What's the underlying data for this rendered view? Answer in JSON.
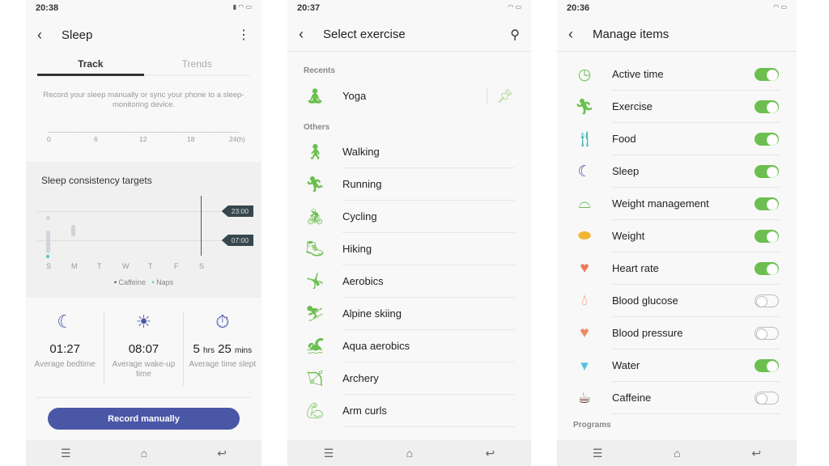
{
  "sleep": {
    "time": "20:38",
    "title": "Sleep",
    "tabs": [
      "Track",
      "Trends"
    ],
    "hint": "Record your sleep manually or sync your phone to a sleep-monitoring device.",
    "axis_ticks": [
      "0",
      "6",
      "12",
      "18",
      "24(h)"
    ],
    "consistency": {
      "title": "Sleep consistency targets",
      "targets": [
        "23:00",
        "07:00"
      ],
      "days": [
        "S",
        "M",
        "T",
        "W",
        "T",
        "F",
        "S"
      ],
      "legend": [
        "Caffeine",
        "Naps"
      ],
      "legend_colors": [
        "#5a3a3a",
        "#4fc3c8"
      ]
    },
    "stats": [
      {
        "icon": "moon-icon",
        "value": "01:27",
        "label": "Average bedtime"
      },
      {
        "icon": "sunrise-icon",
        "value": "08:07",
        "label": "Average wake-up time"
      },
      {
        "icon": "stopwatch-icon",
        "hrs": "5",
        "hrs_unit": "hrs",
        "mins": "25",
        "mins_unit": "mins",
        "label": "Average time slept"
      }
    ],
    "record_button": "Record manually",
    "accent": "#4a56a6"
  },
  "exercise": {
    "time": "20:37",
    "title": "Select exercise",
    "recents_label": "Recents",
    "recents": [
      "Yoga"
    ],
    "others_label": "Others",
    "others": [
      "Walking",
      "Running",
      "Cycling",
      "Hiking",
      "Aerobics",
      "Alpine skiing",
      "Aqua aerobics",
      "Archery",
      "Arm curls"
    ],
    "accent": "#6bbf4e"
  },
  "manage": {
    "time": "20:36",
    "title": "Manage items",
    "items": [
      {
        "label": "Active time",
        "icon": "clock-icon",
        "on": true
      },
      {
        "label": "Exercise",
        "icon": "runner-icon",
        "on": true
      },
      {
        "label": "Food",
        "icon": "fork-knife-icon",
        "on": true
      },
      {
        "label": "Sleep",
        "icon": "moon-icon",
        "on": true
      },
      {
        "label": "Weight management",
        "icon": "weight-management-icon",
        "on": true
      },
      {
        "label": "Weight",
        "icon": "scale-icon",
        "on": true
      },
      {
        "label": "Heart rate",
        "icon": "heart-rate-icon",
        "on": true
      },
      {
        "label": "Blood glucose",
        "icon": "drop-icon",
        "on": false
      },
      {
        "label": "Blood pressure",
        "icon": "heart-icon",
        "on": false
      },
      {
        "label": "Water",
        "icon": "cup-icon",
        "on": true
      },
      {
        "label": "Caffeine",
        "icon": "coffee-icon",
        "on": false
      }
    ],
    "programs_label": "Programs"
  }
}
